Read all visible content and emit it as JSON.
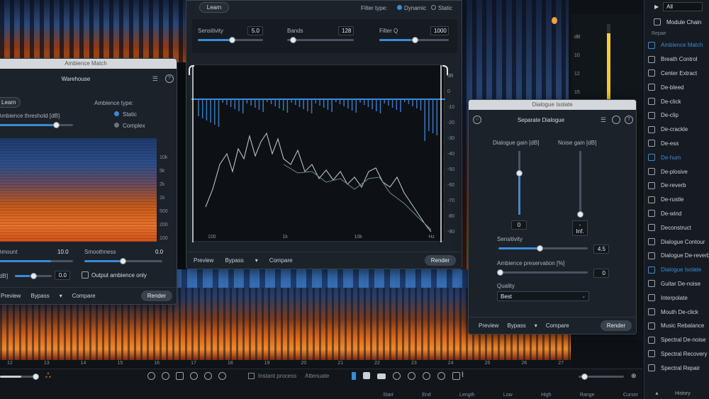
{
  "main_plugin": {
    "learn_label": "Learn",
    "filter_type_label": "Filter type:",
    "filter_dynamic": "Dynamic",
    "filter_static": "Static",
    "sensitivity_label": "Sensitivity",
    "sensitivity_value": "5.0",
    "bands_label": "Bands",
    "bands_value": "128",
    "filterq_label": "Filter Q",
    "filterq_value": "1000",
    "freq_ticks": [
      "100",
      "1k",
      "10k",
      "Hz"
    ],
    "db_ticks": [
      "dB",
      "0",
      "-10",
      "-20",
      "-30",
      "-40",
      "-50",
      "-60",
      "-70",
      "-80",
      "-90"
    ],
    "preview_label": "Preview",
    "bypass_label": "Bypass",
    "compare_label": "Compare",
    "render_label": "Render"
  },
  "ambience_panel": {
    "title": "Ambience Match",
    "preset": "Warehouse",
    "learn_label": "Learn",
    "threshold_label": "Ambience threshold [dB]",
    "ambience_type_label": "Ambience type:",
    "type_static": "Static",
    "type_complex": "Complex",
    "freq_ticks": [
      "10k",
      "5k",
      "2k",
      "1k",
      "500",
      "200",
      "100"
    ],
    "amount_label": "Amount",
    "amount_value": "10.0",
    "smoothness_label": "Smoothness",
    "smoothness_value": "0.0",
    "db_label": "[dB]",
    "db_value": "0.0",
    "output_only_label": "Output ambience only",
    "preview_label": "Preview",
    "bypass_label": "Bypass",
    "compare_label": "Compare",
    "render_label": "Render"
  },
  "dialogue_panel": {
    "title": "Dialogue Isolate",
    "preset": "Separate Dialogue",
    "dialogue_gain_label": "Dialogue gain [dB]",
    "dialogue_gain_value": "0",
    "dialogue_gain_level": 0.65,
    "noise_gain_label": "Noise gain [dB]",
    "noise_gain_value": "-Inf.",
    "noise_gain_level": 0.0,
    "sensitivity_label": "Sensitivity",
    "sensitivity_value": "4.5",
    "ambience_preservation_label": "Ambience preservation [%]",
    "ambience_preservation_value": "0",
    "quality_label": "Quality",
    "quality_value": "Best",
    "preview_label": "Preview",
    "bypass_label": "Bypass",
    "compare_label": "Compare",
    "render_label": "Render"
  },
  "sidebar": {
    "filter_value": "All",
    "module_chain_label": "Module Chain",
    "section_label": "Repair",
    "items": [
      {
        "label": "Ambience Match",
        "icon": "ambience-icon",
        "active": true
      },
      {
        "label": "Breath Control",
        "icon": "breath-icon",
        "active": false
      },
      {
        "label": "Center Extract",
        "icon": "center-icon",
        "active": false
      },
      {
        "label": "De-bleed",
        "icon": "debleed-icon",
        "active": false
      },
      {
        "label": "De-click",
        "icon": "declick-icon",
        "active": false
      },
      {
        "label": "De-clip",
        "icon": "declip-icon",
        "active": false
      },
      {
        "label": "De-crackle",
        "icon": "decrackle-icon",
        "active": false
      },
      {
        "label": "De-ess",
        "icon": "deess-icon",
        "active": false
      },
      {
        "label": "De-hum",
        "icon": "dehum-icon",
        "active": true
      },
      {
        "label": "De-plosive",
        "icon": "deplosive-icon",
        "active": false
      },
      {
        "label": "De-reverb",
        "icon": "dereverb-icon",
        "active": false
      },
      {
        "label": "De-rustle",
        "icon": "derustle-icon",
        "active": false
      },
      {
        "label": "De-wind",
        "icon": "dewind-icon",
        "active": false
      },
      {
        "label": "Deconstruct",
        "icon": "deconstruct-icon",
        "active": false
      },
      {
        "label": "Dialogue Contour",
        "icon": "contour-icon",
        "active": false
      },
      {
        "label": "Dialogue De-reverb",
        "icon": "dialogue-dereverb-icon",
        "active": false
      },
      {
        "label": "Dialogue Isolate",
        "icon": "isolate-icon",
        "active": true
      },
      {
        "label": "Guitar De-noise",
        "icon": "guitar-icon",
        "active": false
      },
      {
        "label": "Interpolate",
        "icon": "interpolate-icon",
        "active": false
      },
      {
        "label": "Mouth De-click",
        "icon": "mouth-icon",
        "active": false
      },
      {
        "label": "Music Rebalance",
        "icon": "music-icon",
        "active": false
      },
      {
        "label": "Spectral De-noise",
        "icon": "spectral-denoise-icon",
        "active": false
      },
      {
        "label": "Spectral Recovery",
        "icon": "spectral-recovery-icon",
        "active": false
      },
      {
        "label": "Spectral Repair",
        "icon": "spectral-repair-icon",
        "active": false
      }
    ],
    "history_label": "History"
  },
  "bottom_toolbar": {
    "instant_process_label": "Instant process",
    "attenuate_value": "Attenuate",
    "time_ticks": [
      "12",
      "13",
      "14",
      "15",
      "16",
      "17",
      "18",
      "19",
      "20",
      "21",
      "22",
      "23",
      "24",
      "25",
      "26",
      "27"
    ],
    "status_labels": [
      "Start",
      "End",
      "Length",
      "Low",
      "High",
      "Range",
      "Cursor"
    ]
  },
  "colors": {
    "accent": "#3a8bd8",
    "meter": "#f2d23a"
  }
}
